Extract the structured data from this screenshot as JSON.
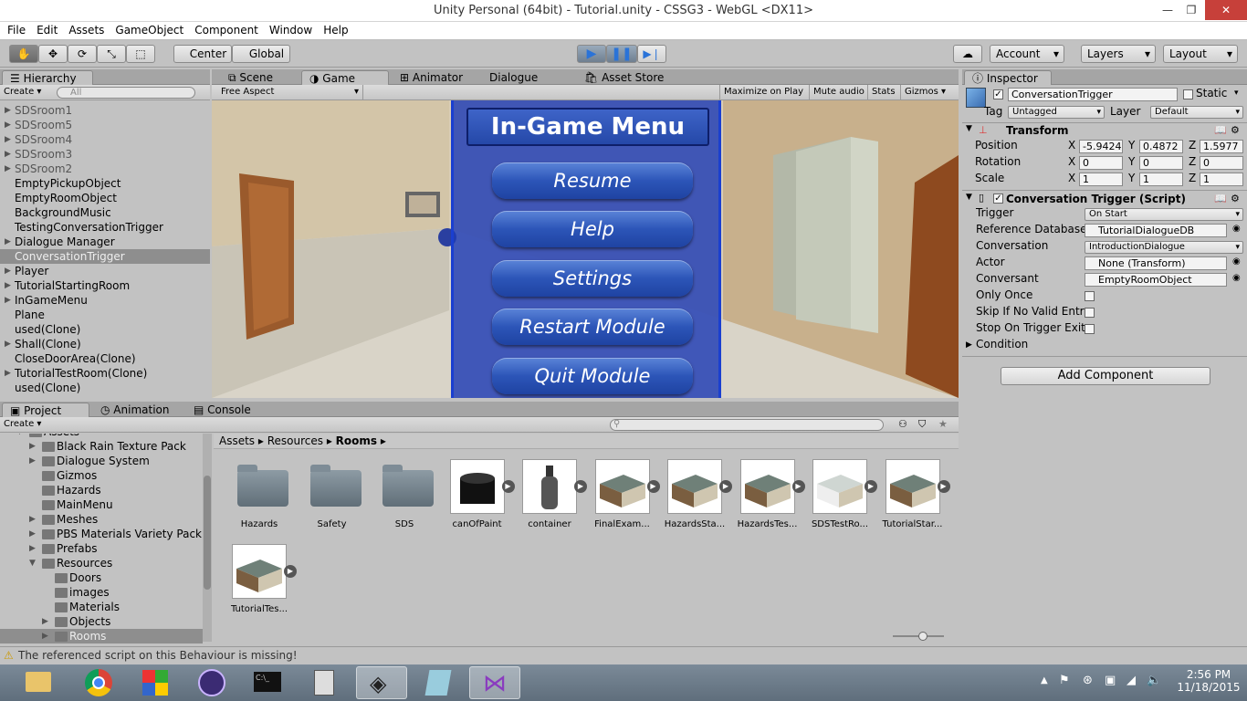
{
  "window": {
    "title": "Unity Personal (64bit) - Tutorial.unity - CSSG3 - WebGL <DX11>",
    "min": "—",
    "max": "❐",
    "close": "✕"
  },
  "menu": [
    "File",
    "Edit",
    "Assets",
    "GameObject",
    "Component",
    "Window",
    "Help"
  ],
  "toolbar": {
    "center": "Center",
    "global": "Global",
    "account": "Account",
    "layers": "Layers",
    "layout": "Layout"
  },
  "hierarchy": {
    "tab": "Hierarchy",
    "create": "Create",
    "search_placeholder": "All",
    "items": [
      {
        "label": "SDSroom1",
        "arrow": "▶",
        "grey": true
      },
      {
        "label": "SDSroom5",
        "arrow": "▶",
        "grey": true
      },
      {
        "label": "SDSroom4",
        "arrow": "▶",
        "grey": true
      },
      {
        "label": "SDSroom3",
        "arrow": "▶",
        "grey": true
      },
      {
        "label": "SDSroom2",
        "arrow": "▶",
        "grey": true
      },
      {
        "label": "EmptyPickupObject",
        "arrow": "",
        "grey": false
      },
      {
        "label": "EmptyRoomObject",
        "arrow": "",
        "grey": false
      },
      {
        "label": "BackgroundMusic",
        "arrow": "",
        "grey": false
      },
      {
        "label": "TestingConversationTrigger",
        "arrow": "",
        "grey": false
      },
      {
        "label": "Dialogue Manager",
        "arrow": "▶",
        "grey": false
      },
      {
        "label": "ConversationTrigger",
        "arrow": "",
        "grey": false,
        "selected": true
      },
      {
        "label": "Player",
        "arrow": "▶",
        "grey": false
      },
      {
        "label": "TutorialStartingRoom",
        "arrow": "▶",
        "grey": false
      },
      {
        "label": "InGameMenu",
        "arrow": "▶",
        "grey": false
      },
      {
        "label": "Plane",
        "arrow": "",
        "grey": false
      },
      {
        "label": "used(Clone)",
        "arrow": "",
        "grey": false
      },
      {
        "label": "Shall(Clone)",
        "arrow": "▶",
        "grey": false
      },
      {
        "label": "CloseDoorArea(Clone)",
        "arrow": "",
        "grey": false
      },
      {
        "label": "TutorialTestRoom(Clone)",
        "arrow": "▶",
        "grey": false
      },
      {
        "label": "used(Clone)",
        "arrow": "",
        "grey": false
      }
    ]
  },
  "center_tabs": {
    "scene": "Scene",
    "game": "Game",
    "animator": "Animator",
    "dialogue": "Dialogue",
    "asset_store": "Asset Store"
  },
  "game_bar": {
    "aspect": "Free Aspect",
    "maximize": "Maximize on Play",
    "mute": "Mute audio",
    "stats": "Stats",
    "gizmos": "Gizmos"
  },
  "game_menu": {
    "title": "In-Game Menu",
    "buttons": [
      "Resume",
      "Help",
      "Settings",
      "Restart Module",
      "Quit Module"
    ]
  },
  "project": {
    "tabs": {
      "project": "Project",
      "animation": "Animation",
      "console": "Console"
    },
    "create": "Create",
    "tree": [
      {
        "label": "Assets",
        "indent": 0,
        "arrow": "▼"
      },
      {
        "label": "Black Rain Texture Pack",
        "indent": 1,
        "arrow": "▶"
      },
      {
        "label": "Dialogue System",
        "indent": 1,
        "arrow": "▶"
      },
      {
        "label": "Gizmos",
        "indent": 1,
        "arrow": ""
      },
      {
        "label": "Hazards",
        "indent": 1,
        "arrow": ""
      },
      {
        "label": "MainMenu",
        "indent": 1,
        "arrow": ""
      },
      {
        "label": "Meshes",
        "indent": 1,
        "arrow": "▶"
      },
      {
        "label": "PBS Materials Variety Pack",
        "indent": 1,
        "arrow": "▶"
      },
      {
        "label": "Prefabs",
        "indent": 1,
        "arrow": "▶"
      },
      {
        "label": "Resources",
        "indent": 1,
        "arrow": "▼"
      },
      {
        "label": "Doors",
        "indent": 2,
        "arrow": ""
      },
      {
        "label": "images",
        "indent": 2,
        "arrow": ""
      },
      {
        "label": "Materials",
        "indent": 2,
        "arrow": ""
      },
      {
        "label": "Objects",
        "indent": 2,
        "arrow": "▶"
      },
      {
        "label": "Rooms",
        "indent": 2,
        "arrow": "▶",
        "selected": true
      }
    ],
    "breadcrumb": [
      "Assets",
      "Resources",
      "Rooms"
    ],
    "assets": [
      {
        "label": "Hazards",
        "kind": "folder"
      },
      {
        "label": "Safety",
        "kind": "folder"
      },
      {
        "label": "SDS",
        "kind": "folder"
      },
      {
        "label": "canOfPaint",
        "kind": "can"
      },
      {
        "label": "container",
        "kind": "bottle"
      },
      {
        "label": "FinalExam...",
        "kind": "room"
      },
      {
        "label": "HazardsSta...",
        "kind": "room"
      },
      {
        "label": "HazardsTes...",
        "kind": "room"
      },
      {
        "label": "SDSTestRo...",
        "kind": "roomwhite"
      },
      {
        "label": "TutorialStar...",
        "kind": "room"
      },
      {
        "label": "TutorialTes...",
        "kind": "room"
      }
    ]
  },
  "inspector": {
    "tab": "Inspector",
    "object_name": "ConversationTrigger",
    "static": "Static",
    "tag_label": "Tag",
    "tag": "Untagged",
    "layer_label": "Layer",
    "layer": "Default",
    "transform": {
      "title": "Transform",
      "position": "Position",
      "rotation": "Rotation",
      "scale": "Scale",
      "pos": [
        "-5.9424",
        "0.4872",
        "1.5977"
      ],
      "rot": [
        "0",
        "0",
        "0"
      ],
      "scl": [
        "1",
        "1",
        "1"
      ]
    },
    "script": {
      "title": "Conversation Trigger (Script)",
      "fields": [
        {
          "label": "Trigger",
          "value": "On Start",
          "type": "popup"
        },
        {
          "label": "Reference Database",
          "value": "TutorialDialogueDB",
          "type": "object"
        },
        {
          "label": "Conversation",
          "value": "IntroductionDialogue",
          "type": "popup"
        },
        {
          "label": "Actor",
          "value": "None (Transform)",
          "type": "object"
        },
        {
          "label": "Conversant",
          "value": "EmptyRoomObject",
          "type": "object"
        },
        {
          "label": "Only Once",
          "value": "",
          "type": "check"
        },
        {
          "label": "Skip If No Valid Entr",
          "value": "",
          "type": "check"
        },
        {
          "label": "Stop On Trigger Exit",
          "value": "",
          "type": "check"
        }
      ],
      "condition": "Condition"
    },
    "add_component": "Add Component"
  },
  "status": "The referenced script on this Behaviour is missing!",
  "clock": {
    "time": "2:56 PM",
    "date": "11/18/2015"
  }
}
